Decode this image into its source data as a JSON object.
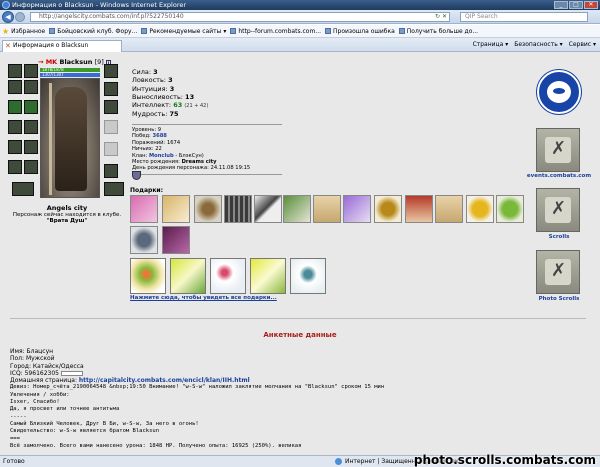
{
  "window": {
    "title": "Информация о Blacksun - Windows Internet Explorer",
    "min": "_",
    "max": "□",
    "close": "✕"
  },
  "address": {
    "url": "http://angelscity.combats.com/inf.pl?522750140",
    "search_placeholder": "QIP Search"
  },
  "favorites": {
    "label": "Избранное",
    "items": [
      "Бойцовский клуб. Фору...",
      "Рекомендуемые сайты ▾",
      "http--forum.combats.com...",
      "Произошла ошибка",
      "Получить больше до..."
    ]
  },
  "tab": {
    "title": "Информация о Blacksun",
    "commands": [
      "Страница ▾",
      "Безопасность ▾",
      "Сервис ▾"
    ]
  },
  "character": {
    "prefix": "→ MK",
    "name": "Blacksun",
    "level": "[9]",
    "info_icon": "i",
    "hp": "1878/1878",
    "mp": "1307/1307",
    "city": "Angels city",
    "location_text": "Персонаж сейчас находится в клубе.",
    "club": "\"Врата Душ\""
  },
  "stats": {
    "strength_label": "Сила:",
    "strength": "3",
    "agility_label": "Ловкость:",
    "agility": "3",
    "intuition_label": "Интуиция:",
    "intuition": "3",
    "endurance_label": "Выносливость:",
    "endurance": "13",
    "intellect_label": "Интеллект:",
    "intellect": "63",
    "intellect_ext": "(21 + 42)",
    "wisdom_label": "Мудрость:",
    "wisdom": "75"
  },
  "details": {
    "level_label": "Уровень:",
    "level": "9",
    "wins_label": "Побед:",
    "wins": "3688",
    "losses_label": "Поражений:",
    "losses": "1674",
    "draws_label": "Ничьих:",
    "draws": "22",
    "clan_label": "Клан:",
    "clan": "Monclub",
    "clan_suffix": "- БлэкСун)",
    "birthplace_label": "Место рождения:",
    "birthplace": "Dreams city",
    "birthday_label": "День рождения персонажа:",
    "birthday": "24.11.08 19:15"
  },
  "gifts": {
    "label": "Подарки:",
    "link": "Нажмите сюда, чтобы увидеть все подарки..."
  },
  "right": {
    "events_label": "events.combats.com",
    "scrolls_label": "Scrolls",
    "photo_scrolls_label": "Photo Scrolls"
  },
  "profile": {
    "section_title": "Анкетные данные",
    "name": "Имя: Блацсун",
    "gender": "Пол: Мужской",
    "city": "Город: Катайск/Одесса",
    "icq": "ICQ: 596162305",
    "homepage_label": "Домашняя страница:",
    "homepage": "http://capitalcity.combats.com/encicl/klan/IIH.html",
    "motto": "Девиз: Номер_счёта_2190064548 &nbsp;19:50 Внимание! \"w-S-w\" наложил заклятие молчания на \"Blacksun\" сроком 15 мин",
    "hobbies": "Увлечения / хобби:",
    "line1": "Isxer, Спасибо!",
    "line2": "Да, я просвет или точнее антитьма",
    "line3": "-----",
    "line4": "Самый Близкий Человек, Друг В Би, w-S-w, За него в огонь!",
    "line5": "Свидетельство: w-S-w является братом Blacksun",
    "line6": "===",
    "line7": "Всё замолчено. Всего вами нанесено урона: 1848 HP. Получено опыта: 16925 (250%).  великая"
  },
  "status": {
    "done": "Готово",
    "zone": "Интернет | Защищенный режим: вкл."
  },
  "watermark": "photo.scrolls.combats.com",
  "colors": {
    "section_title": "#a8201a",
    "link": "#1a3f9a",
    "hp": "#3c9a2b",
    "mp": "#3b6ccf"
  }
}
